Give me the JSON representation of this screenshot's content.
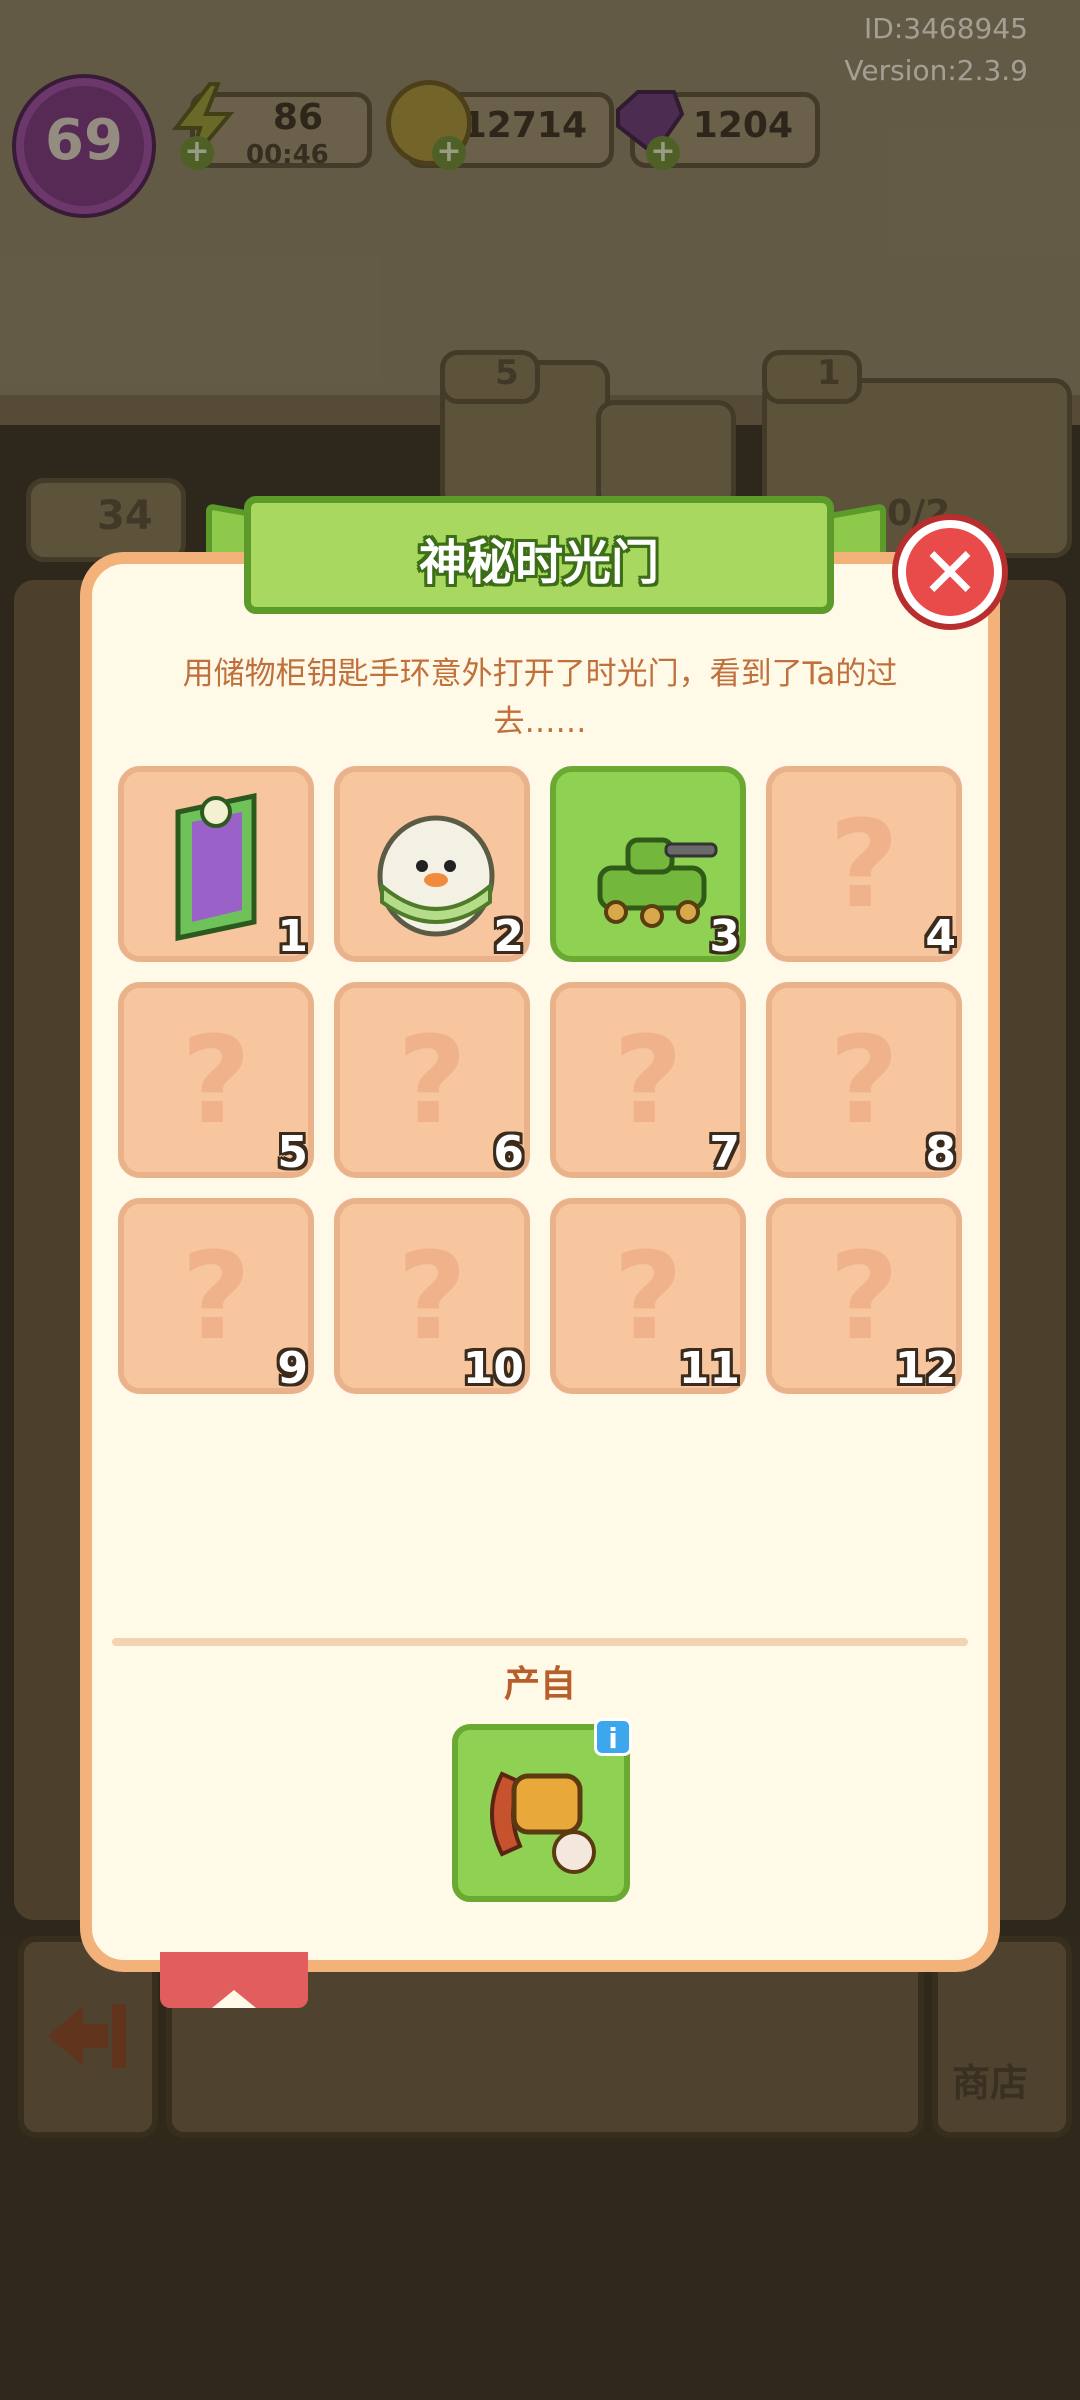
{
  "hud": {
    "id_text": "ID:3468945",
    "version_text": "Version:2.3.9",
    "level": "69",
    "energy": "86",
    "energy_timer": "00:46",
    "coins": "12714",
    "gems": "1204"
  },
  "background": {
    "stars_left": "34",
    "stars_mid": "5",
    "stars_right": "1",
    "progress": "0/2",
    "shop_label": "商店"
  },
  "dialog": {
    "title": "神秘时光门",
    "description": "用储物柜钥匙手环意外打开了时光门，看到了Ta的过去……",
    "source_label": "产自",
    "unknown_mark": "?",
    "info_mark": "i",
    "close_mark": "✕",
    "slots": [
      {
        "number": "1",
        "state": "unlocked",
        "icon": "time-door-icon"
      },
      {
        "number": "2",
        "state": "unlocked",
        "icon": "egg-duck-icon"
      },
      {
        "number": "3",
        "state": "current",
        "icon": "green-tank-icon"
      },
      {
        "number": "4",
        "state": "locked",
        "icon": "question-icon"
      },
      {
        "number": "5",
        "state": "locked",
        "icon": "question-icon"
      },
      {
        "number": "6",
        "state": "locked",
        "icon": "question-icon"
      },
      {
        "number": "7",
        "state": "locked",
        "icon": "question-icon"
      },
      {
        "number": "8",
        "state": "locked",
        "icon": "question-icon"
      },
      {
        "number": "9",
        "state": "locked",
        "icon": "question-icon"
      },
      {
        "number": "10",
        "state": "locked",
        "icon": "question-icon"
      },
      {
        "number": "11",
        "state": "locked",
        "icon": "question-icon"
      },
      {
        "number": "12",
        "state": "locked",
        "icon": "question-icon"
      }
    ],
    "source_icon": "locker-key-bracelet-icon"
  },
  "colors": {
    "ribbon_green": "#a8d85f",
    "slot_peach": "#f7c59e",
    "slot_active": "#8fd253",
    "close_red": "#e94a4a",
    "dialog_bg": "#fff9e8"
  }
}
